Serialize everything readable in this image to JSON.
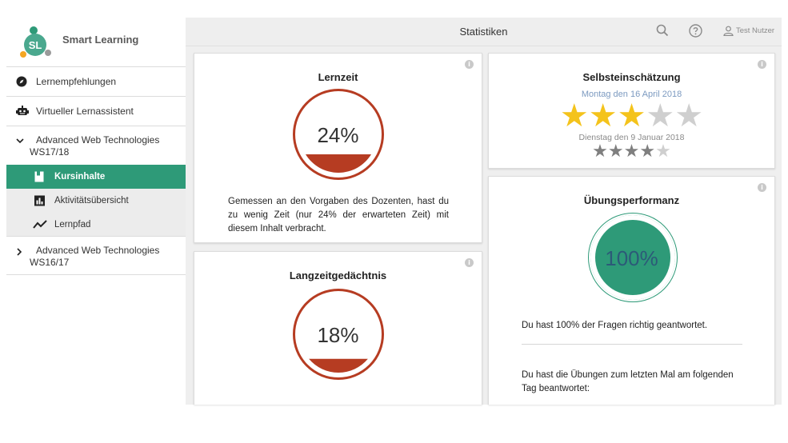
{
  "app": {
    "name": "Smart Learning",
    "logo_text": "SL"
  },
  "header": {
    "title": "Statistiken",
    "user": "Test Nutzer"
  },
  "sidebar": {
    "items": [
      {
        "label": "Lernempfehlungen"
      },
      {
        "label": "Virtueller Lernassistent"
      }
    ],
    "course1": {
      "line1": "Advanced Web Technologies",
      "line2": "WS17/18",
      "sub": [
        {
          "label": "Kursinhalte",
          "active": true
        },
        {
          "label": "Aktivitätsübersicht"
        },
        {
          "label": "Lernpfad"
        }
      ]
    },
    "course2": {
      "line1": "Advanced Web Technologies",
      "line2": "WS16/17"
    }
  },
  "cards": {
    "lernzeit": {
      "title": "Lernzeit",
      "value": "24%",
      "fill": 0.24,
      "description": "Gemessen an den Vorgaben des Dozenten, hast du zu wenig Zeit (nur 24% der erwarteten Zeit) mit diesem Inhalt verbracht."
    },
    "langzeit": {
      "title": "Langzeitgedächtnis",
      "value": "18%",
      "fill": 0.18
    },
    "selbst": {
      "title": "Selbsteinschätzung",
      "date1": "Montag den 16 April 2018",
      "rating1": 3,
      "date2": "Dienstag den 9 Januar 2018",
      "rating2": 4,
      "max": 5
    },
    "uebung": {
      "title": "Übungsperformanz",
      "value": "100%",
      "fill": 1.0,
      "text1": "Du hast 100% der Fragen richtig geantwortet.",
      "text2": "Du hast die Übungen zum letzten Mal am folgenden Tag beantwortet:"
    }
  },
  "colors": {
    "accent": "#2e9a78",
    "danger": "#b63c22",
    "star_gold": "#f4c31b",
    "star_gray": "#cfcfcf",
    "star_dark": "#7f7f7f"
  }
}
